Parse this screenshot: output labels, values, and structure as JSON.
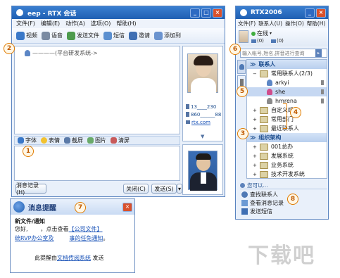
{
  "chat_window": {
    "title": "eep   - RTX 会话",
    "menu": [
      "文件(F)",
      "编辑(E)",
      "动作(A)",
      "选项(O)",
      "帮助(H)"
    ],
    "toolbar": [
      {
        "label": "视频",
        "icon": "video-icon"
      },
      {
        "label": "语音",
        "icon": "microphone-icon"
      },
      {
        "label": "发送文件",
        "icon": "send-file-icon"
      },
      {
        "label": "短信",
        "icon": "sms-icon"
      },
      {
        "label": "邀请",
        "icon": "invite-icon"
      },
      {
        "label": "添加到",
        "icon": "add-to-icon"
      }
    ],
    "participant_line": "————(平台研发系统->",
    "format_bar": [
      {
        "label": "字体",
        "icon": "font-icon"
      },
      {
        "label": "表情",
        "icon": "emoticon-icon"
      },
      {
        "label": "截屏",
        "icon": "screenshot-icon"
      },
      {
        "label": "图片",
        "icon": "image-icon"
      },
      {
        "label": "清屏",
        "icon": "clear-icon"
      }
    ],
    "history_button": "消息记录(H)",
    "close_button": "关闭(C)",
    "send_button": "发送(S)",
    "contact_info": {
      "phone": "13____230",
      "tel": "860______88",
      "email": "rtx.com"
    }
  },
  "rtx_main": {
    "title": "RTX2006",
    "menu": [
      "文件(F)",
      "联系人(U)",
      "操作(O)",
      "帮助(H)"
    ],
    "status": "在线",
    "mail_count": "(0)",
    "sms_count": "(0)",
    "search_placeholder": "输入帐号,姓名,拼音进行查询",
    "contacts_header": "联系人",
    "group_common": "常用联系人(2/3)",
    "contacts": [
      "arkyi",
      "she",
      "hmrena"
    ],
    "custom_groups": [
      "自定义组",
      "常用部门",
      "最近联系人"
    ],
    "org_header": "组织架构",
    "org_items": [
      "001总办",
      "发展系统",
      "业务系统",
      "技术开发系统"
    ],
    "you_label": "您可以...",
    "actions": [
      "查找联系人",
      "查看消息记录",
      "发送短信"
    ]
  },
  "notification": {
    "title": "消息提醒",
    "subject": "新文件/通知",
    "greeting": "您好,",
    "body_pre": "，点击查看",
    "body_link": "【公司文件】",
    "line2_link_a": "统RVP办公室及",
    "line2_link_b": "事的任免通知",
    "line2_tail": "。",
    "footer_pre": "此提醒由",
    "footer_link": "文档传阅系统",
    "footer_post": " 发送"
  },
  "callouts": [
    "1",
    "2",
    "4",
    "5",
    "6",
    "7",
    "8",
    "3"
  ],
  "watermark": "下载吧",
  "colors": {
    "title": "#2464bd",
    "callout": "#e07b00",
    "link": "#1a53b8"
  }
}
